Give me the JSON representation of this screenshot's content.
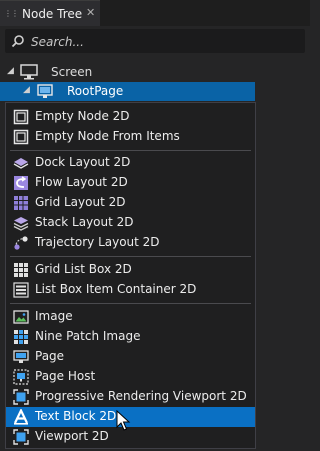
{
  "tab": {
    "title": "Node Tree",
    "close": "✕"
  },
  "search": {
    "placeholder": "Search..."
  },
  "tree": {
    "screen_label": "Screen",
    "root_label": "RootPage"
  },
  "menu": {
    "items": [
      {
        "label": "Empty Node 2D",
        "icon": "empty-node-icon"
      },
      {
        "label": "Empty Node From Items",
        "icon": "empty-node-icon"
      },
      {
        "label": "Dock Layout 2D",
        "icon": "dock-layout-icon"
      },
      {
        "label": "Flow Layout 2D",
        "icon": "flow-layout-icon"
      },
      {
        "label": "Grid Layout 2D",
        "icon": "grid-layout-icon"
      },
      {
        "label": "Stack Layout 2D",
        "icon": "stack-layout-icon"
      },
      {
        "label": "Trajectory Layout 2D",
        "icon": "trajectory-layout-icon"
      },
      {
        "label": "Grid List Box 2D",
        "icon": "grid-list-box-icon"
      },
      {
        "label": "List Box Item Container 2D",
        "icon": "list-box-icon"
      },
      {
        "label": "Image",
        "icon": "image-icon"
      },
      {
        "label": "Nine Patch Image",
        "icon": "nine-patch-icon"
      },
      {
        "label": "Page",
        "icon": "page-icon"
      },
      {
        "label": "Page Host",
        "icon": "page-host-icon"
      },
      {
        "label": "Progressive Rendering Viewport 2D",
        "icon": "viewport-icon"
      },
      {
        "label": "Text Block 2D",
        "icon": "text-block-icon"
      },
      {
        "label": "Viewport 2D",
        "icon": "viewport-icon"
      }
    ],
    "highlighted_index": 14
  },
  "colors": {
    "selection": "#0a63a6",
    "menu_highlight": "#0a70c4",
    "accent_blue": "#3fa2f0"
  }
}
